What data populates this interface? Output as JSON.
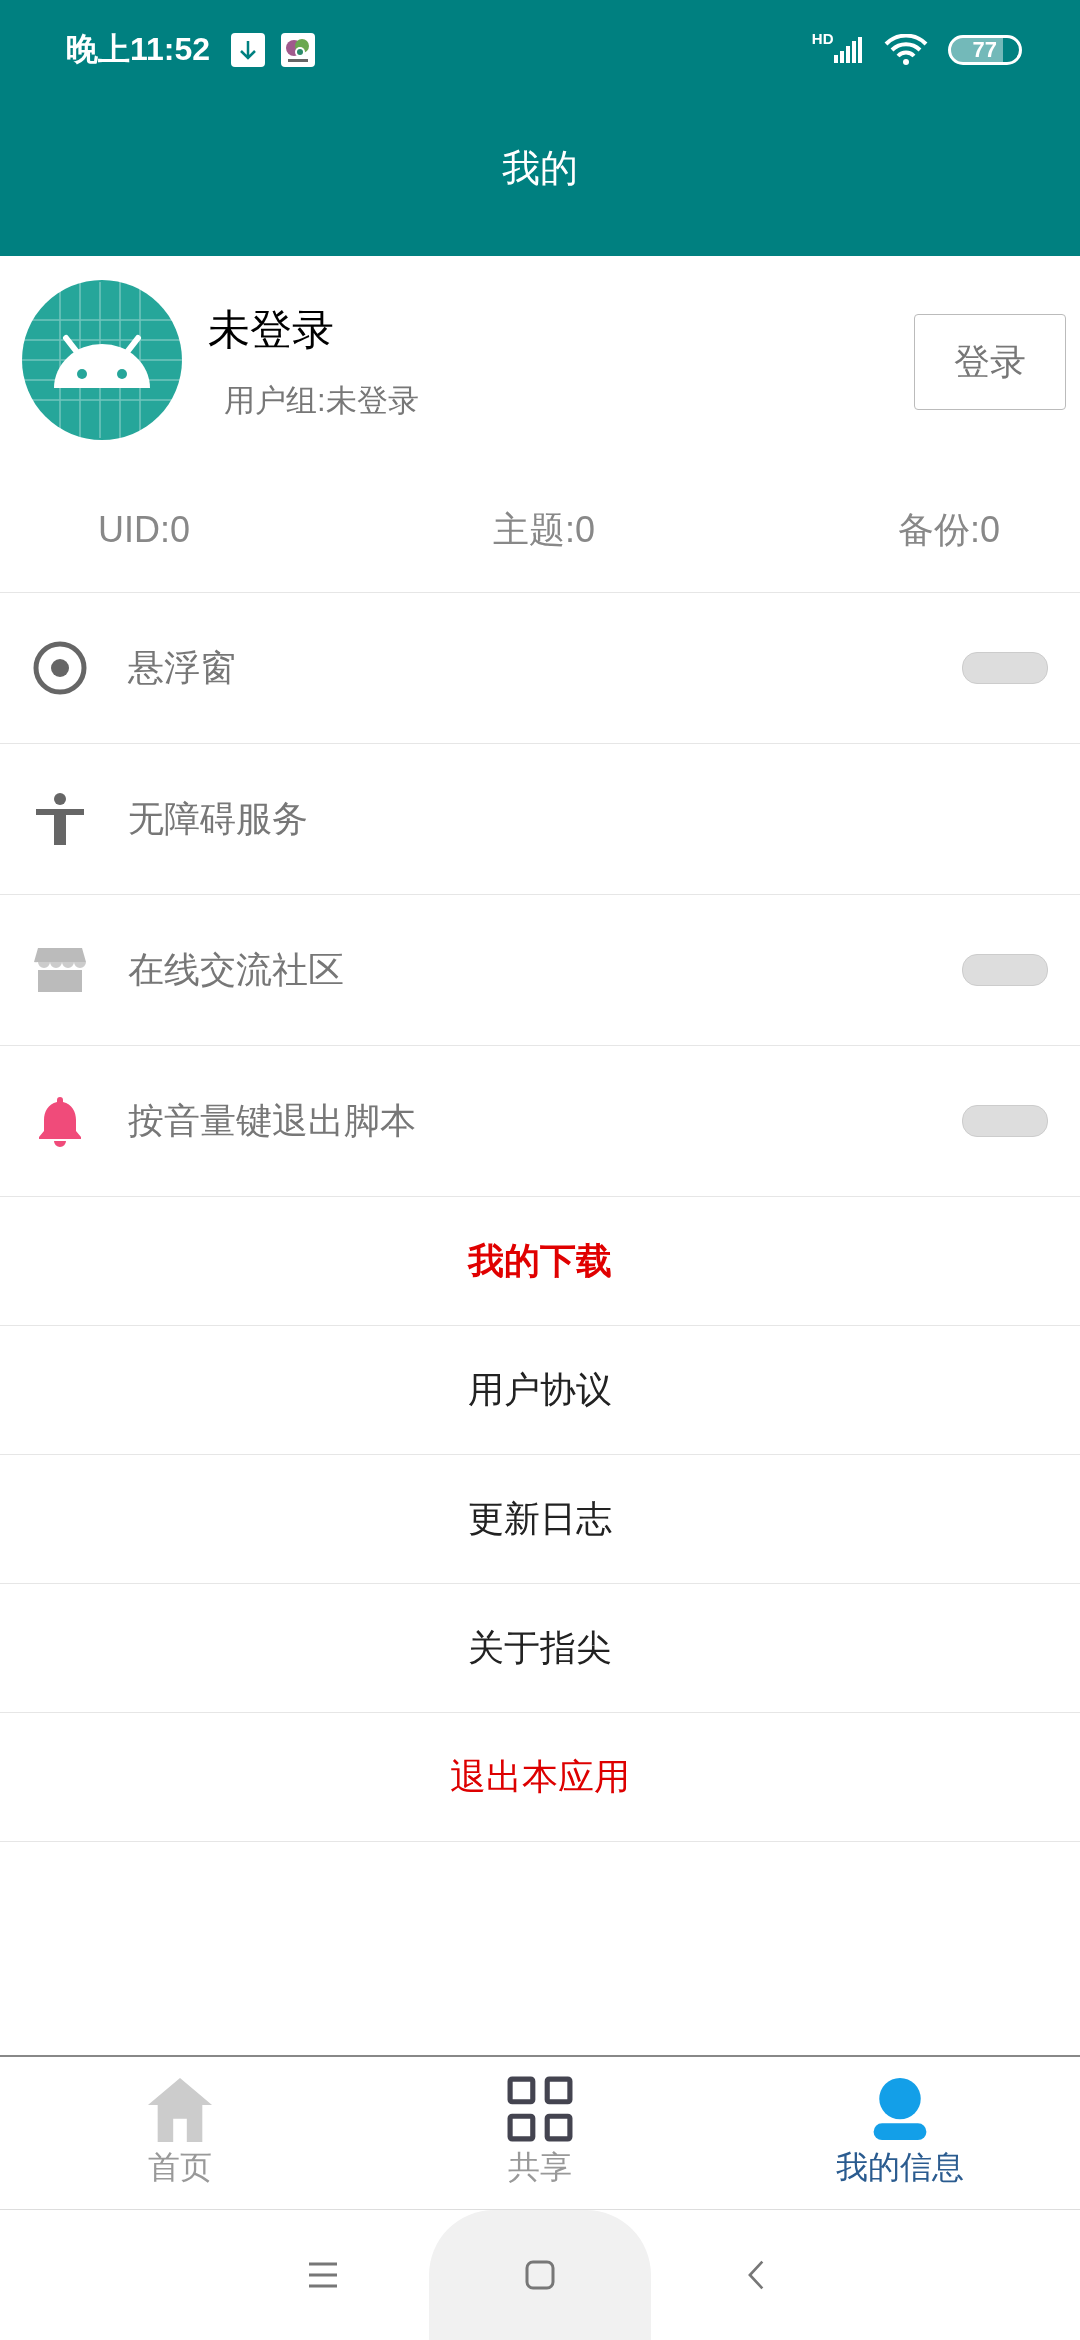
{
  "status_bar": {
    "time": "晚上11:52",
    "network": "HD",
    "battery": "77"
  },
  "header": {
    "title": "我的"
  },
  "profile": {
    "name": "未登录",
    "group": "用户组:未登录",
    "login_button": "登录"
  },
  "stats": [
    "UID:0",
    "主题:0",
    "备份:0"
  ],
  "settings": [
    {
      "label": "悬浮窗",
      "kind": "toggle",
      "on": false
    },
    {
      "label": "无障碍服务",
      "kind": "plain"
    },
    {
      "label": "在线交流社区",
      "kind": "toggle",
      "on": false
    },
    {
      "label": "按音量键退出脚本",
      "kind": "toggle",
      "on": false
    }
  ],
  "menu": [
    {
      "label": "我的下载",
      "kind": "highlight"
    },
    {
      "label": "用户协议",
      "kind": "normal"
    },
    {
      "label": "更新日志",
      "kind": "normal"
    },
    {
      "label": "关于指尖",
      "kind": "normal"
    },
    {
      "label": "退出本应用",
      "kind": "danger"
    }
  ],
  "bottom_nav": [
    {
      "label": "首页",
      "selected": false
    },
    {
      "label": "共享",
      "selected": false
    },
    {
      "label": "我的信息",
      "selected": true
    }
  ]
}
